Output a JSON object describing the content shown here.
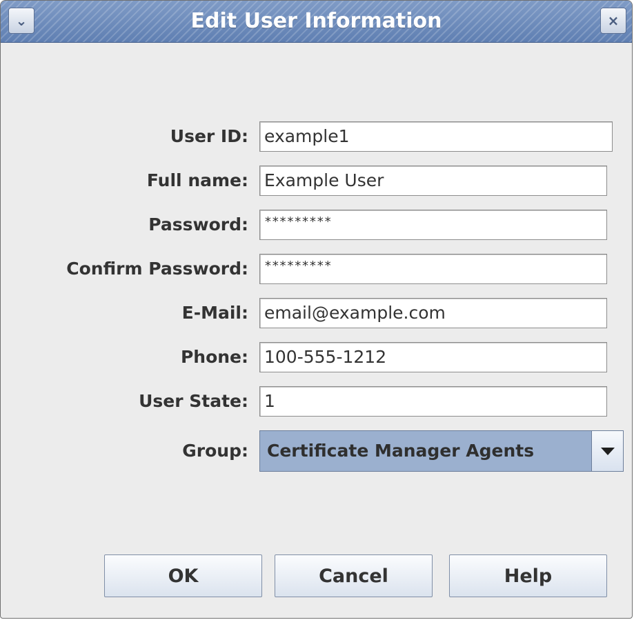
{
  "window": {
    "title": "Edit User Information",
    "menu_icon": "chevron-down",
    "close_icon": "close"
  },
  "form": {
    "user_id": {
      "label": "User ID:",
      "value": "example1"
    },
    "full_name": {
      "label": "Full name:",
      "value": "Example User"
    },
    "password": {
      "label": "Password:",
      "value": "*********"
    },
    "confirm_password": {
      "label": "Confirm Password:",
      "value": "*********"
    },
    "email": {
      "label": "E-Mail:",
      "value": "email@example.com"
    },
    "phone": {
      "label": "Phone:",
      "value": "100-555-1212"
    },
    "user_state": {
      "label": "User State:",
      "value": "1"
    },
    "group": {
      "label": "Group:",
      "value": "Certificate Manager Agents"
    }
  },
  "buttons": {
    "ok": "OK",
    "cancel": "Cancel",
    "help": "Help"
  },
  "colors": {
    "titlebar": "#6f8dbc",
    "window_bg": "#ececec",
    "combo_bg": "#9bb0cf"
  }
}
